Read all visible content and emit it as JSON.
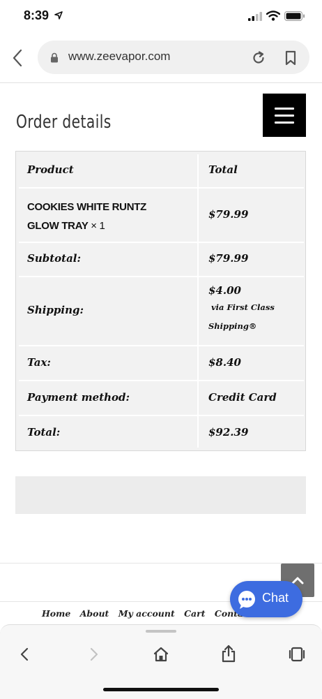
{
  "status": {
    "time": "8:39"
  },
  "browser": {
    "url": "www.zeevapor.com"
  },
  "page": {
    "title": "Order details"
  },
  "order": {
    "header": {
      "product": "Product",
      "total": "Total"
    },
    "item": {
      "name_line1": "COOKIES WHITE RUNTZ",
      "name_line2": "GLOW TRAY",
      "qty": "× 1",
      "total": "$79.99"
    },
    "subtotal": {
      "label": "Subtotal:",
      "value": "$79.99"
    },
    "shipping": {
      "label": "Shipping:",
      "value": "$4.00",
      "via_line1": "via First Class",
      "via_line2": "Shipping®"
    },
    "tax": {
      "label": "Tax:",
      "value": "$8.40"
    },
    "payment": {
      "label": "Payment method:",
      "value": "Credit Card"
    },
    "total": {
      "label": "Total:",
      "value": "$92.39"
    }
  },
  "footer": {
    "links": [
      "Home",
      "About",
      "My account",
      "Cart",
      "Contact"
    ]
  },
  "chat": {
    "label": "Chat"
  },
  "colors": {
    "chat": "#3d6ce0",
    "menu": "#000000",
    "scroll_top": "#6f6f6f"
  }
}
